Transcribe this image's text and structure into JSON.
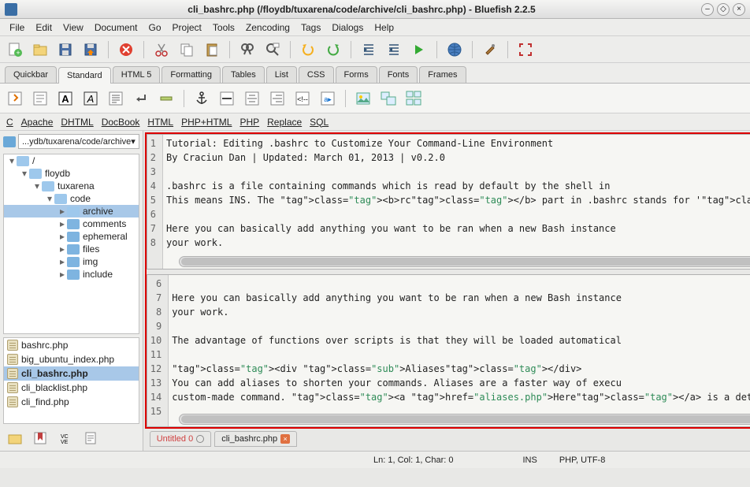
{
  "window": {
    "title": "cli_bashrc.php (/floydb/tuxarena/code/archive/cli_bashrc.php) - Bluefish 2.2.5"
  },
  "menubar": [
    "File",
    "Edit",
    "View",
    "Document",
    "Go",
    "Project",
    "Tools",
    "Zencoding",
    "Tags",
    "Dialogs",
    "Help"
  ],
  "toolbar_tabs": [
    "Quickbar",
    "Standard",
    "HTML 5",
    "Formatting",
    "Tables",
    "List",
    "CSS",
    "Forms",
    "Fonts",
    "Frames"
  ],
  "active_toolbar_tab": "Standard",
  "langbar": [
    "C",
    "Apache",
    "DHTML",
    "DocBook",
    "HTML",
    "PHP+HTML",
    "PHP",
    "Replace",
    "SQL"
  ],
  "path_selector": "...ydb/tuxarena/code/archive",
  "tree": [
    {
      "depth": 0,
      "expander": "▾",
      "label": "/",
      "open": true
    },
    {
      "depth": 1,
      "expander": "▾",
      "label": "floydb",
      "open": true
    },
    {
      "depth": 2,
      "expander": "▾",
      "label": "tuxarena",
      "open": true
    },
    {
      "depth": 3,
      "expander": "▾",
      "label": "code",
      "open": true
    },
    {
      "depth": 4,
      "expander": "▸",
      "label": "archive",
      "open": true,
      "sel": true
    },
    {
      "depth": 4,
      "expander": "▸",
      "label": "comments"
    },
    {
      "depth": 4,
      "expander": "▸",
      "label": "ephemeral"
    },
    {
      "depth": 4,
      "expander": "▸",
      "label": "files"
    },
    {
      "depth": 4,
      "expander": "▸",
      "label": "img"
    },
    {
      "depth": 4,
      "expander": "▸",
      "label": "include"
    }
  ],
  "file_list": [
    {
      "name": "bashrc.php"
    },
    {
      "name": "big_ubuntu_index.php"
    },
    {
      "name": "cli_bashrc.php",
      "sel": true
    },
    {
      "name": "cli_blacklist.php"
    },
    {
      "name": "cli_find.php"
    }
  ],
  "code_top": {
    "start": 1,
    "lines": [
      "Tutorial: Editing .bashrc to Customize Your Command-Line Environment",
      "By Craciun Dan | Updated: March 01, 2013 | v0.2.0",
      "",
      ".bashrc is a file containing commands which is read by default by the shell in ",
      "This means INS. The <b>rc</b> part in .bashrc stands for '<b>r</b>un <b>c</b>om",
      "",
      "Here you can basically add anything you want to be ran when a new Bash instance",
      "your work."
    ]
  },
  "code_bottom": {
    "start": 6,
    "lines": [
      "",
      "Here you can basically add anything you want to be ran when a new Bash instance",
      "your work.",
      "",
      "The advantage of functions over scripts is that they will be loaded automatical",
      "",
      "<div class=\"sub\">Aliases</div>",
      "You can add aliases to shorten your commands. Aliases are a faster way of execu",
      "custom-made command. <a href=\"aliases.php\">Here</a> is a detailed tutorial on h",
      ""
    ]
  },
  "editor_tabs": [
    {
      "label": "Untitled 0",
      "dirty": false,
      "untitled": true
    },
    {
      "label": "cli_bashrc.php",
      "dirty": true
    }
  ],
  "status": {
    "position": "Ln: 1, Col: 1, Char: 0",
    "mode": "INS",
    "filetype": "PHP, UTF-8"
  },
  "icons": {
    "new": "new-file-icon",
    "open": "open-icon",
    "save": "save-icon",
    "saveas": "save-as-icon",
    "close": "close-doc-icon",
    "cut": "cut-icon",
    "copy": "copy-icon",
    "paste": "paste-icon",
    "find": "find-icon",
    "findrep": "find-replace-icon",
    "undo": "undo-icon",
    "redo": "redo-icon",
    "unindent": "unindent-icon",
    "indent": "indent-icon",
    "web": "web-preview-icon",
    "pref": "preferences-icon",
    "full": "fullscreen-icon"
  }
}
